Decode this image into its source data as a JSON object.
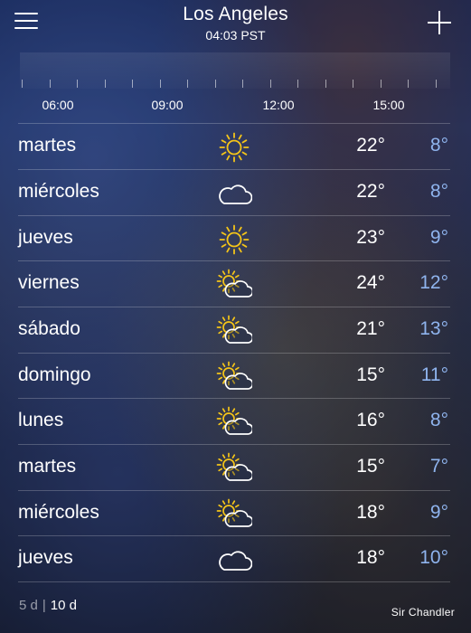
{
  "header": {
    "city": "Los Angeles",
    "local_time": "04:03 PST",
    "menu_icon": "hamburger-menu-icon",
    "add_icon": "plus-icon"
  },
  "hourly": {
    "labels": [
      "06:00",
      "09:00",
      "12:00",
      "15:00"
    ]
  },
  "forecast": [
    {
      "day": "martes",
      "icon": "sun-icon",
      "high": "22°",
      "low": "8°"
    },
    {
      "day": "miércoles",
      "icon": "cloud-icon",
      "high": "22°",
      "low": "8°"
    },
    {
      "day": "jueves",
      "icon": "sun-icon",
      "high": "23°",
      "low": "9°"
    },
    {
      "day": "viernes",
      "icon": "partly-cloudy-icon",
      "high": "24°",
      "low": "12°"
    },
    {
      "day": "sábado",
      "icon": "partly-cloudy-icon",
      "high": "21°",
      "low": "13°"
    },
    {
      "day": "domingo",
      "icon": "partly-cloudy-icon",
      "high": "15°",
      "low": "11°"
    },
    {
      "day": "lunes",
      "icon": "partly-cloudy-icon",
      "high": "16°",
      "low": "8°"
    },
    {
      "day": "martes",
      "icon": "partly-cloudy-icon",
      "high": "15°",
      "low": "7°"
    },
    {
      "day": "miércoles",
      "icon": "partly-cloudy-icon",
      "high": "18°",
      "low": "9°"
    },
    {
      "day": "jueves",
      "icon": "cloud-icon",
      "high": "18°",
      "low": "10°"
    }
  ],
  "range_toggle": {
    "option_5": "5 d",
    "separator": "|",
    "option_10": "10 d",
    "selected": "10 d"
  },
  "watermark": "Sir Chandler",
  "colors": {
    "sun": "#f5c518",
    "low_temp": "#8fb4ee",
    "text": "#ffffff"
  }
}
